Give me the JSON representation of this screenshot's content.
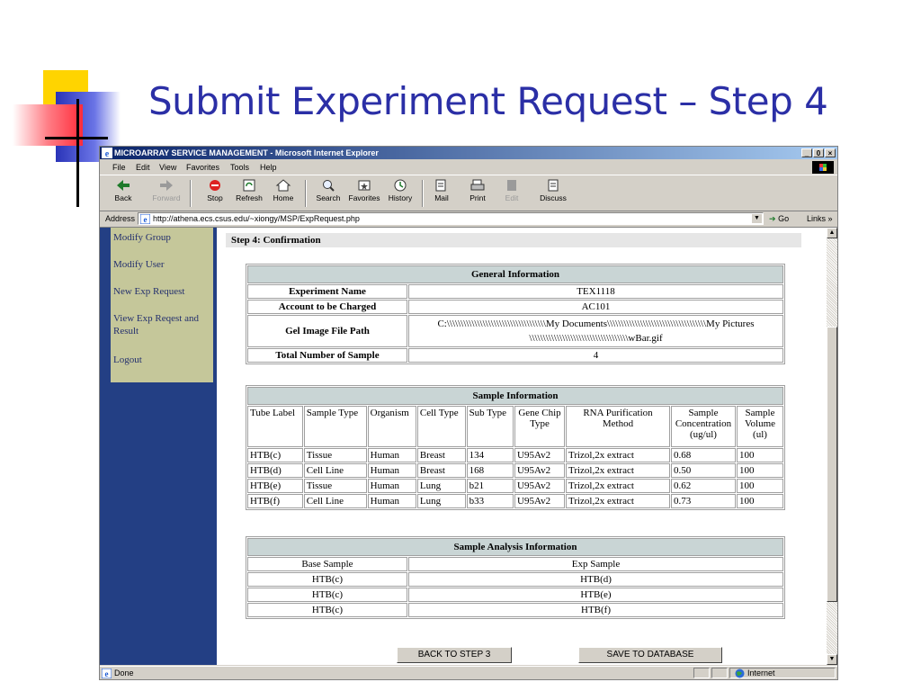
{
  "slide": {
    "title": "Submit Experiment Request – Step 4"
  },
  "window": {
    "title": "MICROARRAY SERVICE MANAGEMENT - Microsoft Internet Explorer",
    "controls": [
      "_",
      "0",
      "×"
    ]
  },
  "menu": {
    "items": [
      "File",
      "Edit",
      "View",
      "Favorites",
      "Tools",
      "Help"
    ]
  },
  "toolbar": {
    "buttons": [
      {
        "label": "Back",
        "icon": "back-arrow-icon"
      },
      {
        "label": "Forward",
        "icon": "forward-arrow-icon"
      },
      {
        "label": "Stop",
        "icon": "stop-icon"
      },
      {
        "label": "Refresh",
        "icon": "refresh-icon"
      },
      {
        "label": "Home",
        "icon": "home-icon"
      },
      {
        "label": "Search",
        "icon": "search-icon"
      },
      {
        "label": "Favorites",
        "icon": "favorites-icon"
      },
      {
        "label": "History",
        "icon": "history-icon"
      },
      {
        "label": "Mail",
        "icon": "mail-icon"
      },
      {
        "label": "Print",
        "icon": "print-icon"
      },
      {
        "label": "Edit",
        "icon": "edit-icon"
      },
      {
        "label": "Discuss",
        "icon": "discuss-icon"
      }
    ]
  },
  "address": {
    "label": "Address",
    "url": "http://athena.ecs.csus.edu/~xiongy/MSP/ExpRequest.php",
    "go_label": "Go",
    "links_label": "Links »"
  },
  "nav": {
    "items": [
      "Modify Group",
      "Modify User",
      "New Exp Request",
      "View Exp Reqest and Result",
      "Logout"
    ]
  },
  "step_title": "Step 4: Confirmation",
  "general": {
    "heading": "General Information",
    "rows": [
      {
        "label": "Experiment Name",
        "value": "TEX1118"
      },
      {
        "label": "Account to be Charged",
        "value": "AC101"
      },
      {
        "label": "Gel Image File Path",
        "value": "C:\\\\\\\\\\\\\\\\\\\\\\\\\\\\\\\\\\\\\\\\\\\\\\\\\\\\\\\\\\\\\\\\\\\\\\\\My Documents\\\\\\\\\\\\\\\\\\\\\\\\\\\\\\\\\\\\\\\\\\\\\\\\\\\\\\\\\\\\\\\\\\\\\\\\My Pictures\\\\\\\\\\\\\\\\\\\\\\\\\\\\\\\\\\\\\\\\\\\\\\\\\\\\\\\\\\\\\\\\\\\\\\\\wBar.gif"
      },
      {
        "label": "Total Number of Sample",
        "value": "4"
      }
    ]
  },
  "samples": {
    "heading": "Sample Information",
    "columns": [
      "Tube Label",
      "Sample Type",
      "Organism",
      "Cell Type",
      "Sub Type",
      "Gene Chip Type",
      "RNA Purification Method",
      "Sample Concentration (ug/ul)",
      "Sample Volume (ul)"
    ],
    "rows": [
      [
        "HTB(c)",
        "Tissue",
        "Human",
        "Breast",
        "134",
        "U95Av2",
        "Trizol,2x extract",
        "0.68",
        "100"
      ],
      [
        "HTB(d)",
        "Cell Line",
        "Human",
        "Breast",
        "168",
        "U95Av2",
        "Trizol,2x extract",
        "0.50",
        "100"
      ],
      [
        "HTB(e)",
        "Tissue",
        "Human",
        "Lung",
        "b21",
        "U95Av2",
        "Trizol,2x extract",
        "0.62",
        "100"
      ],
      [
        "HTB(f)",
        "Cell Line",
        "Human",
        "Lung",
        "b33",
        "U95Av2",
        "Trizol,2x extract",
        "0.73",
        "100"
      ]
    ]
  },
  "analysis": {
    "heading": "Sample Analysis Information",
    "columns": [
      "Base Sample",
      "Exp Sample"
    ],
    "rows": [
      [
        "HTB(c)",
        "HTB(d)"
      ],
      [
        "HTB(c)",
        "HTB(e)"
      ],
      [
        "HTB(c)",
        "HTB(f)"
      ]
    ]
  },
  "buttons": {
    "back": "BACK TO STEP 3",
    "save": "SAVE TO DATABASE"
  },
  "status": {
    "text": "Done",
    "zone": "Internet"
  }
}
